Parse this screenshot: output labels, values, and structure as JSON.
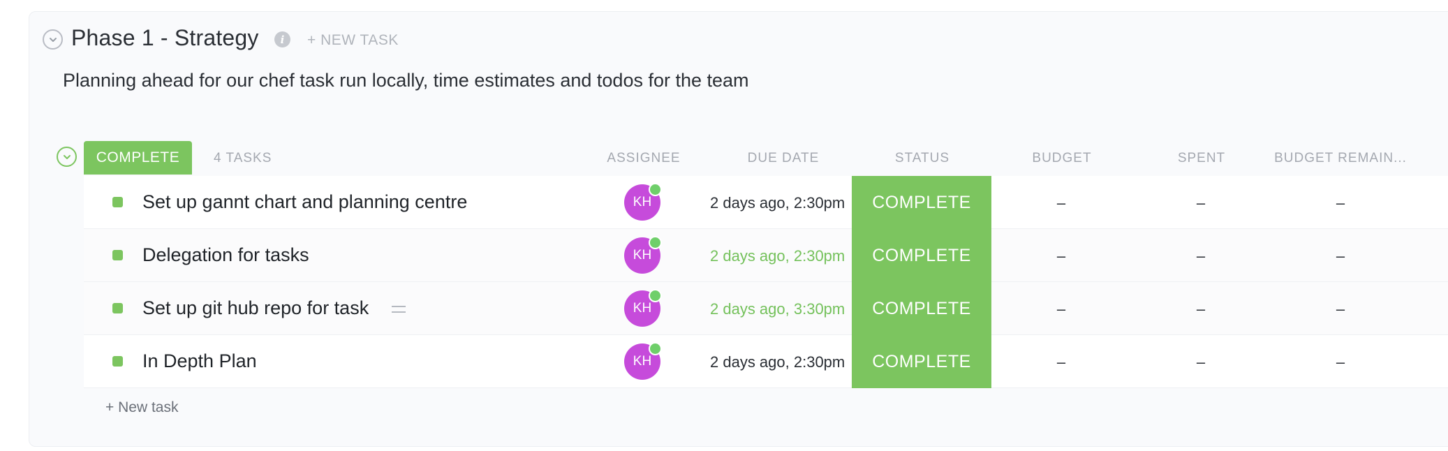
{
  "phase": {
    "title": "Phase 1 - Strategy",
    "new_task_label": "+ NEW TASK",
    "description": "Planning ahead for our chef task run locally, time estimates and todos for the team"
  },
  "group": {
    "status_label": "COMPLETE",
    "task_count": "4 TASKS",
    "accent_color": "#7cc55f"
  },
  "columns": {
    "assignee": "ASSIGNEE",
    "due_date": "DUE DATE",
    "status": "STATUS",
    "budget": "BUDGET",
    "spent": "SPENT",
    "budget_remaining": "BUDGET REMAIN..."
  },
  "tasks": [
    {
      "name": "Set up gannt chart and planning centre",
      "assignee": "KH",
      "due": "2 days ago, 2:30pm",
      "due_color": "default",
      "status": "COMPLETE",
      "budget": "–",
      "spent": "–",
      "remaining": "–",
      "has_description": false
    },
    {
      "name": "Delegation for tasks",
      "assignee": "KH",
      "due": "2 days ago, 2:30pm",
      "due_color": "green",
      "status": "COMPLETE",
      "budget": "–",
      "spent": "–",
      "remaining": "–",
      "has_description": false
    },
    {
      "name": "Set up git hub repo for task",
      "assignee": "KH",
      "due": "2 days ago, 3:30pm",
      "due_color": "green",
      "status": "COMPLETE",
      "budget": "–",
      "spent": "–",
      "remaining": "–",
      "has_description": true
    },
    {
      "name": "In Depth Plan",
      "assignee": "KH",
      "due": "2 days ago, 2:30pm",
      "due_color": "default",
      "status": "COMPLETE",
      "budget": "–",
      "spent": "–",
      "remaining": "–",
      "has_description": false
    }
  ],
  "footer": {
    "new_task_label": "+ New task"
  },
  "icons": {
    "phase_collapse": "chevron-down-icon",
    "group_collapse": "chevron-down-icon",
    "info": "info-icon",
    "description": "description-lines-icon"
  }
}
